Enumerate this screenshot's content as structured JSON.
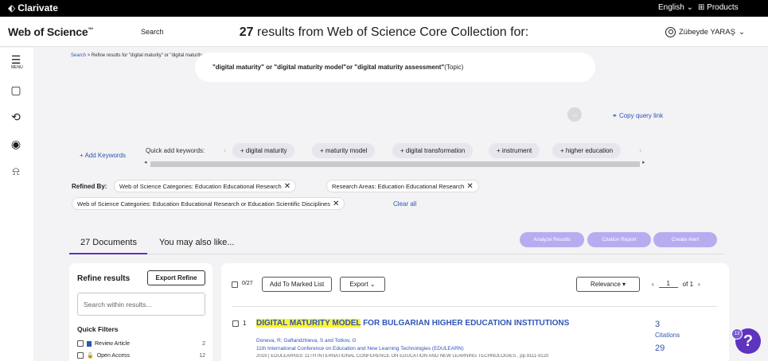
{
  "topbar": {
    "logo": "Clarivate",
    "language": "English ⌄",
    "products": "Products"
  },
  "header": {
    "brand": "Web of Science",
    "brand_tm": "™",
    "nav_search": "Search",
    "user": "Zübeyde YARAŞ"
  },
  "sidebar": {
    "menu_label": "MENU"
  },
  "breadcrumb": {
    "search": "Search",
    "separator": ">",
    "current": "Refine results for \"digital maturity\" or \"digital maturity model\"or \"d..."
  },
  "results": {
    "count": "27",
    "title_rest": " results from Web of Science Core Collection for:"
  },
  "query": {
    "text": "\"digital maturity\" or \"digital maturity model\"or \"digital maturity assessment\"",
    "field": " (Topic)",
    "copy_link": "Copy query link"
  },
  "keywords": {
    "add_label": "+ Add Keywords",
    "quick_label": "Quick add keywords:",
    "chips": [
      "+ digital maturity",
      "+ maturity model",
      "+ digital transformation",
      "+ instrument",
      "+ higher education"
    ]
  },
  "refined": {
    "label": "Refined By:",
    "filters": [
      "Web of Science Categories: Education Educational Research",
      "Research Areas: Education Educational Research",
      "Web of Science Categories: Education Educational Research or Education Scientific Disciplines"
    ],
    "clear_all": "Clear all"
  },
  "tabs": {
    "documents_count": "27",
    "documents_label": " Documents",
    "also_like": "You may also like..."
  },
  "actions": {
    "analyze": "Analyze Results",
    "citation_report": "Citation Report",
    "create_alert": "Create Alert"
  },
  "refine_panel": {
    "title": "Refine results",
    "export": "Export Refine",
    "search_placeholder": "Search within results...",
    "quick_filters": "Quick Filters",
    "filters": [
      {
        "label": "Review Article",
        "count": "2"
      },
      {
        "label": "Open Access",
        "count": "12"
      }
    ]
  },
  "results_panel": {
    "selected": "0/27",
    "add_marked": "Add To Marked List",
    "export": "Export ⌄",
    "sort": "Relevance ▾",
    "page": "1",
    "of_pages": "of 1",
    "item": {
      "number": "1",
      "title_highlight": "DIGITAL MATURITY MODEL",
      "title_rest": " FOR BULGARIAN HIGHER EDUCATION INSTITUTIONS",
      "authors": "Doneva, R; Gaftandzhieva, S and Totkov, G",
      "conference": "11th International Conference on Education and New Learning Technologies (EDULEARN)",
      "meta": "2019 | EDULEARN19: 11TH INTERNATIONAL CONFERENCE ON EDUCATION AND NEW LEARNING TECHNOLOGIES , pp.9111-9120",
      "citations": "3",
      "citations_label": "Citations",
      "refs": "29"
    }
  },
  "help": {
    "badge": "13",
    "glyph": "?"
  }
}
